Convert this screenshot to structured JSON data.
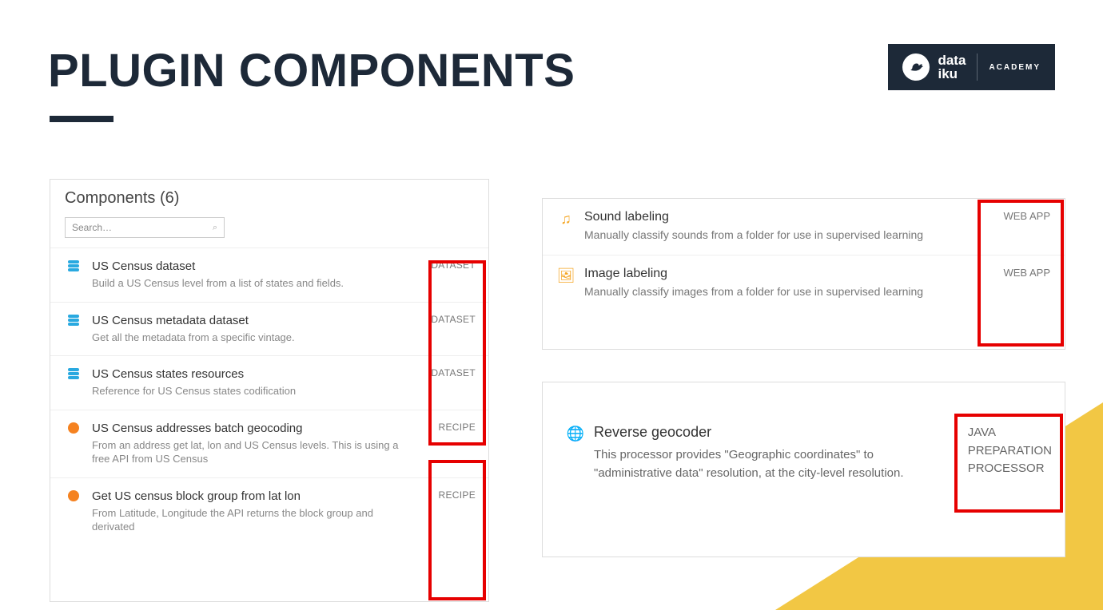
{
  "title": "PLUGIN COMPONENTS",
  "logo": {
    "line1": "data",
    "line2": "iku",
    "academy": "ACADEMY"
  },
  "left_panel": {
    "header": "Components (6)",
    "search_placeholder": "Search…",
    "items": [
      {
        "title": "US Census dataset",
        "desc": "Build a US Census level from a list of states and fields.",
        "tag": "DATASET",
        "icon": "db"
      },
      {
        "title": "US Census metadata dataset",
        "desc": "Get all the metadata from a specific vintage.",
        "tag": "DATASET",
        "icon": "db"
      },
      {
        "title": "US Census states resources",
        "desc": "Reference for US Census states codification",
        "tag": "DATASET",
        "icon": "db"
      },
      {
        "title": "US Census addresses batch geocoding",
        "desc": "From an address get lat, lon and US Census levels. This is using a free API from US Census",
        "tag": "RECIPE",
        "icon": "circle"
      },
      {
        "title": "Get US census block group from lat lon",
        "desc": "From Latitude, Longitude the API returns the block group and derivated",
        "tag": "RECIPE",
        "icon": "circle"
      }
    ]
  },
  "top_right": {
    "items": [
      {
        "title": "Sound labeling",
        "desc": "Manually classify sounds from a folder for use in supervised learning",
        "tag": "WEB APP",
        "icon": "music"
      },
      {
        "title": "Image labeling",
        "desc": "Manually classify images from a folder for use in supervised learning",
        "tag": "WEB APP",
        "icon": "image"
      }
    ]
  },
  "bot_right": {
    "title": "Reverse geocoder",
    "desc": "This processor provides \"Geographic coordinates\" to \"administrative data\" resolution, at the city-level resolution.",
    "tag_l1": "JAVA",
    "tag_l2": "PREPARATION",
    "tag_l3": "PROCESSOR"
  }
}
